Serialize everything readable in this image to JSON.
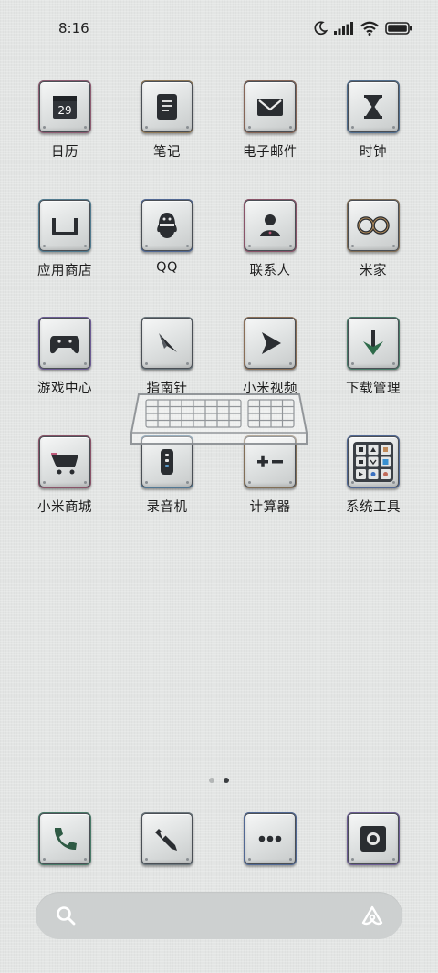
{
  "status_bar": {
    "time": "8:16",
    "icons": [
      "moon-icon",
      "signal-icon",
      "wifi-icon",
      "battery-icon"
    ]
  },
  "apps": [
    {
      "label": "日历",
      "icon": "calendar-icon",
      "date": "29",
      "rim": "#c76a8a"
    },
    {
      "label": "笔记",
      "icon": "notes-icon",
      "rim": "#c99a5a"
    },
    {
      "label": "电子邮件",
      "icon": "mail-icon",
      "rim": "#b87a5a"
    },
    {
      "label": "时钟",
      "icon": "hourglass-icon",
      "rim": "#5a8ac0"
    },
    {
      "label": "应用商店",
      "icon": "app-store-icon",
      "rim": "#5aa0c0"
    },
    {
      "label": "QQ",
      "icon": "qq-penguin-icon",
      "rim": "#5a80c8"
    },
    {
      "label": "联系人",
      "icon": "contacts-icon",
      "rim": "#c05a7a"
    },
    {
      "label": "米家",
      "icon": "mijia-icon",
      "rim": "#b08a5a"
    },
    {
      "label": "游戏中心",
      "icon": "gamepad-icon",
      "rim": "#8a6ac8"
    },
    {
      "label": "指南针",
      "icon": "compass-icon",
      "rim": "#8a9aa0"
    },
    {
      "label": "小米视频",
      "icon": "video-play-icon",
      "rim": "#c08a5a"
    },
    {
      "label": "下载管理",
      "icon": "download-icon",
      "rim": "#4aa07a"
    },
    {
      "label": "小米商城",
      "icon": "shopping-cart-icon",
      "rim": "#c05a7a"
    },
    {
      "label": "录音机",
      "icon": "recorder-icon",
      "rim": "#5a9ac8"
    },
    {
      "label": "计算器",
      "icon": "calculator-icon",
      "rim": "#b08a5a"
    },
    {
      "label": "系统工具",
      "icon": "system-tools-folder-icon",
      "rim": "#5a80c8"
    }
  ],
  "page_indicator": {
    "count": 2,
    "active": 2
  },
  "dock": [
    {
      "icon": "phone-icon",
      "rim": "#4aa07a"
    },
    {
      "icon": "browser-icon",
      "rim": "#8a9aa0"
    },
    {
      "icon": "messages-icon",
      "rim": "#5a80c8"
    },
    {
      "icon": "camera-icon",
      "rim": "#8a6ac8"
    }
  ],
  "search": {
    "placeholder": ""
  }
}
